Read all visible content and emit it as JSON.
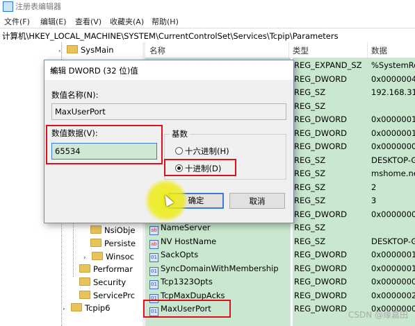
{
  "window": {
    "title": "注册表编辑器"
  },
  "menu": [
    "文件(F)",
    "编辑(E)",
    "查看(V)",
    "收藏夹(A)",
    "帮助(H)"
  ],
  "address": "计算机\\HKEY_LOCAL_MACHINE\\SYSTEM\\CurrentControlSet\\Services\\Tcpip\\Parameters",
  "tree": {
    "top_item": "SysMain",
    "items": [
      "NsiObje",
      "Persiste",
      "Winsoc",
      "Performar",
      "Security",
      "ServicePrc",
      "Tcpip6"
    ]
  },
  "list": {
    "headers": {
      "name": "名称",
      "type": "类型",
      "data": "数据"
    },
    "rows": [
      {
        "name": "",
        "type": "REG_EXPAND_SZ",
        "data": "%SystemRo"
      },
      {
        "name": "",
        "type": "REG_DWORD",
        "data": "0x0000004"
      },
      {
        "name": "",
        "type": "REG_SZ",
        "data": "192.168.31."
      },
      {
        "name": "",
        "type": "REG_SZ",
        "data": ""
      },
      {
        "name": "",
        "type": "REG_DWORD",
        "data": "0x0000001"
      },
      {
        "name": "",
        "type": "REG_DWORD",
        "data": "0x0000001"
      },
      {
        "name": "",
        "type": "REG_DWORD",
        "data": "0x0000000"
      },
      {
        "name": "",
        "type": "REG_SZ",
        "data": "DESKTOP-G"
      },
      {
        "name": "",
        "type": "REG_SZ",
        "data": "mshome.ne"
      },
      {
        "name": "",
        "type": "REG_SZ",
        "data": "2"
      },
      {
        "name": "",
        "type": "REG_SZ",
        "data": "3"
      },
      {
        "name": "",
        "type": "REG_DWORD",
        "data": "0x0000000"
      },
      {
        "name": "NameServer",
        "type": "REG_SZ",
        "data": ""
      },
      {
        "name": "NV HostName",
        "type": "REG_SZ",
        "data": "DESKTOP-G"
      },
      {
        "name": "SackOpts",
        "type": "REG_DWORD",
        "data": "0x0000001"
      },
      {
        "name": "SyncDomainWithMembership",
        "type": "REG_DWORD",
        "data": "0x0000001"
      },
      {
        "name": "Tcp1323Opts",
        "type": "REG_DWORD",
        "data": "0x0000000"
      },
      {
        "name": "TcpMaxDupAcks",
        "type": "REG_DWORD",
        "data": "0x0000002"
      },
      {
        "name": "MaxUserPort",
        "type": "REG_DWORD",
        "data": "0x0000000"
      }
    ]
  },
  "dialog": {
    "title": "编辑 DWORD (32 位)值",
    "name_label": "数值名称(N):",
    "name_value": "MaxUserPort",
    "data_label": "数值数据(V):",
    "data_value": "65534",
    "base_label": "基数",
    "radio_hex": "十六进制(H)",
    "radio_dec": "十进制(D)",
    "selected_base": "dec",
    "ok": "确定",
    "cancel": "取消"
  },
  "watermark": "CSDN @缘嘉田"
}
